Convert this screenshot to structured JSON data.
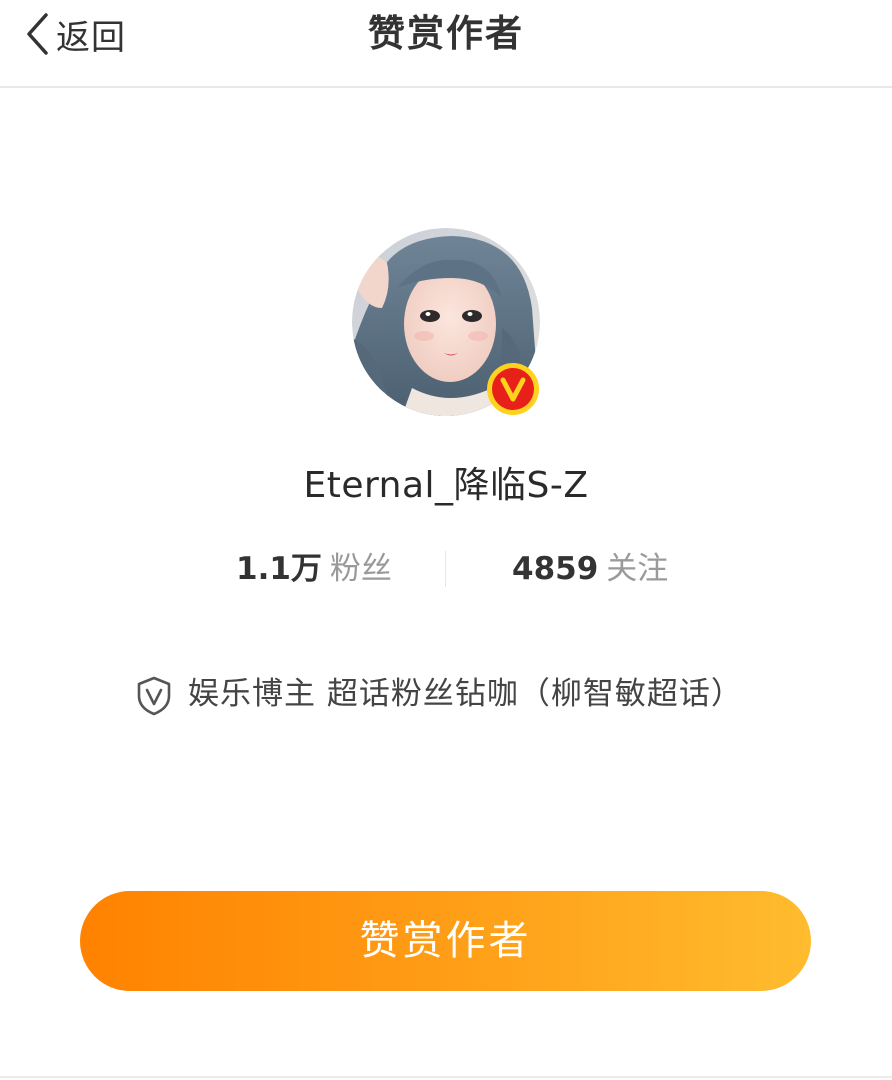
{
  "header": {
    "back_label": "返回",
    "title": "赞赏作者"
  },
  "profile": {
    "username": "Eternal_降临S-Z",
    "verified_badge": "V",
    "stats": {
      "fans_value": "1.1万",
      "fans_label": "粉丝",
      "follow_value": "4859",
      "follow_label": "关注"
    },
    "verification_text": "娱乐博主 超话粉丝钻咖（柳智敏超话）"
  },
  "action": {
    "reward_label": "赞赏作者"
  },
  "colors": {
    "accent_start": "#ff8200",
    "accent_end": "#ffbc2e",
    "badge_red": "#e8201a",
    "badge_yellow": "#ffd21f"
  },
  "icons": {
    "back": "chevron-left-icon",
    "shield": "shield-v-icon",
    "verified": "verified-v-badge-icon"
  }
}
